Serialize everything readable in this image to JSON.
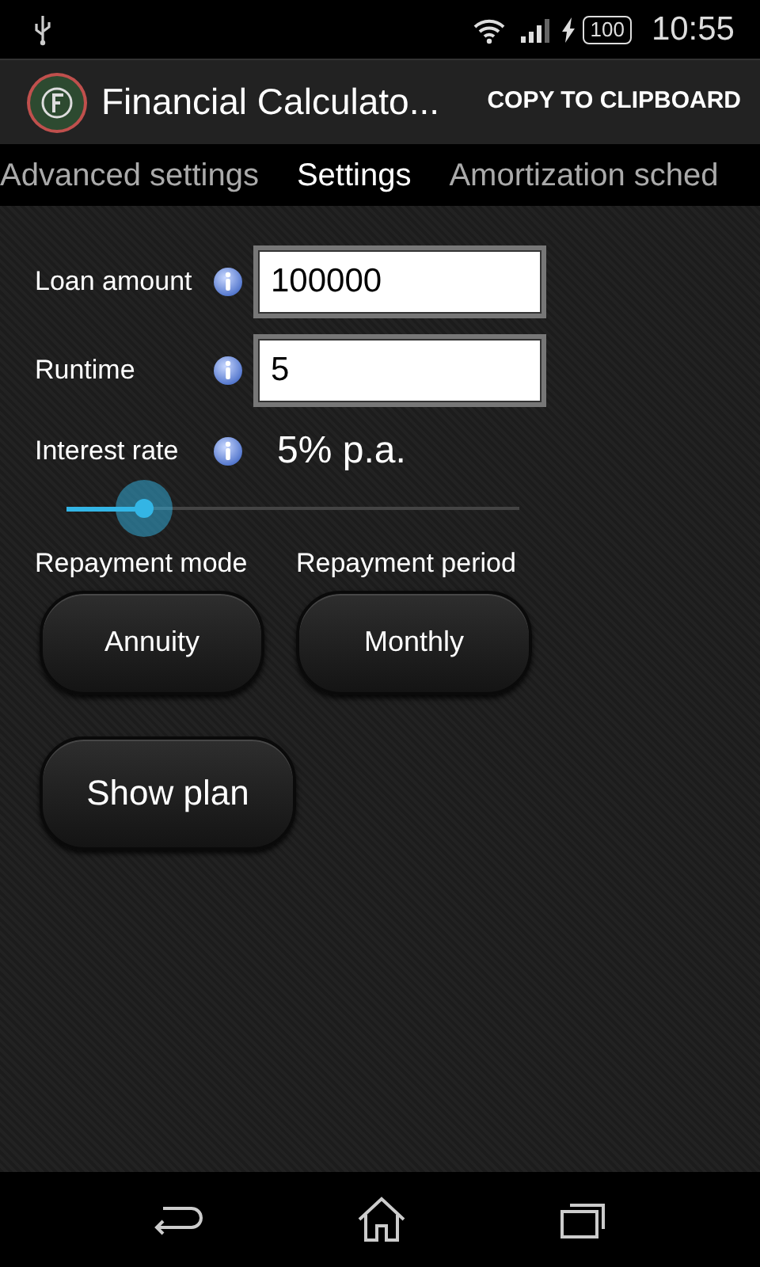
{
  "status_bar": {
    "battery": "100",
    "time": "10:55"
  },
  "action_bar": {
    "title": "Financial Calculato...",
    "action": "COPY TO CLIPBOARD"
  },
  "tabs": [
    {
      "label": "Advanced settings",
      "selected": false
    },
    {
      "label": "Settings",
      "selected": true
    },
    {
      "label": "Amortization sched",
      "selected": false
    }
  ],
  "fields": [
    {
      "label": "Loan amount",
      "value": "100000"
    },
    {
      "label": "Runtime",
      "value": "5"
    }
  ],
  "interest": {
    "label": "Interest rate",
    "reading": "5% p.a.",
    "level": 0.17
  },
  "choices": [
    {
      "label": "Repayment mode",
      "value": "Annuity"
    },
    {
      "label": "Repayment period",
      "value": "Monthly"
    }
  ],
  "show_button": "Show plan"
}
